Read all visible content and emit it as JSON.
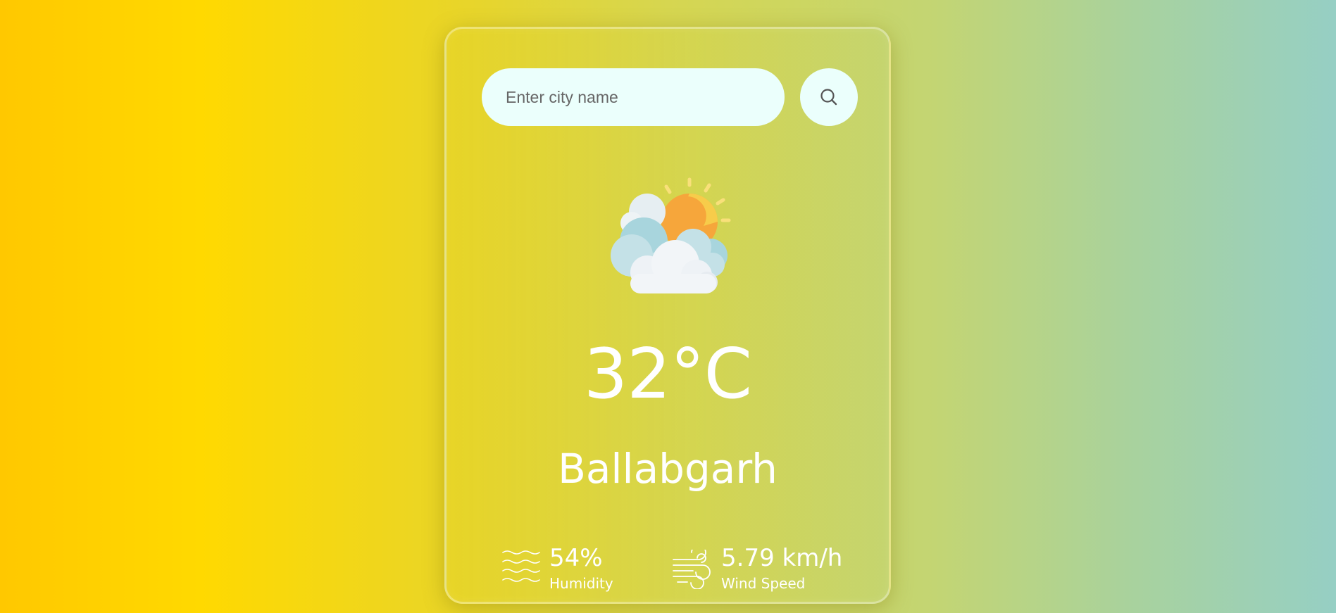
{
  "search": {
    "placeholder": "Enter city name",
    "value": ""
  },
  "icons": {
    "search_button": "search-icon",
    "weather": "partly-cloudy-icon",
    "humidity": "humidity-waves-icon",
    "wind": "wind-icon"
  },
  "weather": {
    "temperature": "32°C",
    "city": "Ballabgarh"
  },
  "details": {
    "humidity_value": "54%",
    "humidity_label": "Humidity",
    "wind_value": "5.79 km/h",
    "wind_label": "Wind Speed"
  },
  "colors": {
    "background_left": "#ffc800",
    "background_right": "#96cfc4",
    "input_bg": "#ebfffc",
    "text": "#ffffff"
  }
}
